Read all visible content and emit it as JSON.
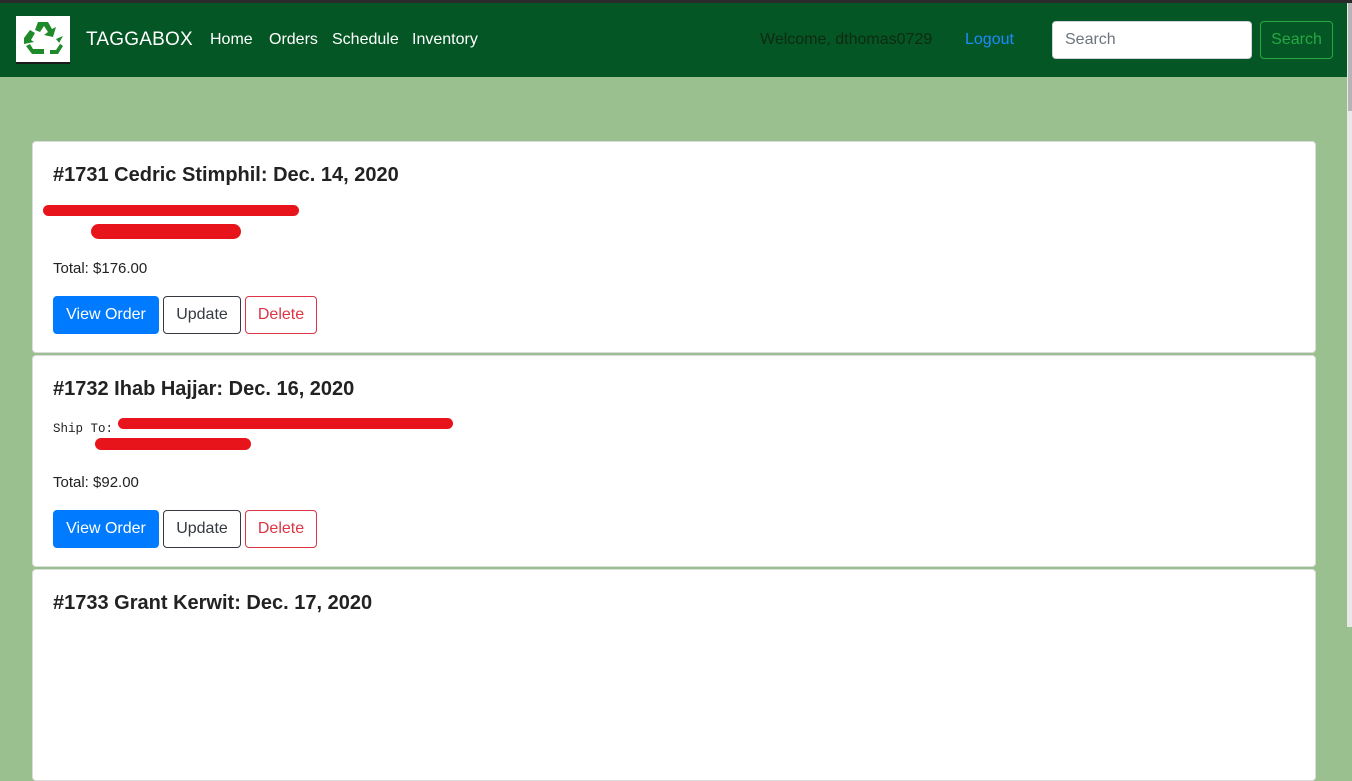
{
  "nav": {
    "brand": "TAGGABOX",
    "links": [
      "Home",
      "Orders",
      "Schedule",
      "Inventory"
    ],
    "welcome": "Welcome, dthomas0729",
    "logout": "Logout",
    "search_placeholder": "Search",
    "search_button": "Search",
    "logo_icon": "recycle-icon",
    "colors": {
      "navbar": "#045624",
      "page_bg": "#9bc08f",
      "primary": "#007bff",
      "danger": "#dc3545",
      "success": "#28a745"
    }
  },
  "orders": [
    {
      "title": "#1731 Cedric Stimphil: Dec. 14, 2020",
      "ship_label": "",
      "total": "Total: $176.00"
    },
    {
      "title": "#1732 Ihab Hajjar: Dec. 16, 2020",
      "ship_label": "Ship To:",
      "total": "Total: $92.00"
    },
    {
      "title": "#1733 Grant Kerwit: Dec. 17, 2020",
      "ship_label": "",
      "total": ""
    }
  ],
  "buttons": {
    "view": "View Order",
    "update": "Update",
    "delete": "Delete"
  }
}
